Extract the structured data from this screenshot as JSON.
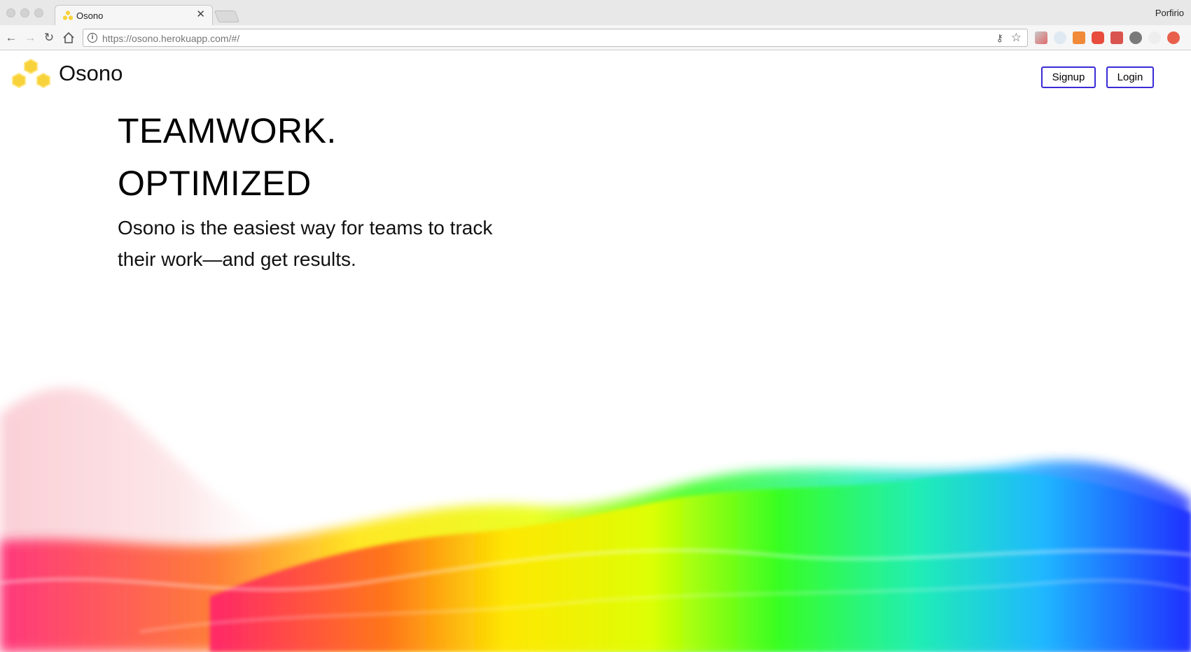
{
  "browser": {
    "tab_title": "Osono",
    "profile_name": "Porfirio",
    "url_host": "https://osono.herokuapp.com",
    "url_path": "/#/"
  },
  "nav": {
    "brand": "Osono",
    "signup_label": "Signup",
    "login_label": "Login"
  },
  "hero": {
    "headline_line1": "TEAMWORK.",
    "headline_line2": "OPTIMIZED",
    "tagline": "Osono is the easiest way for teams to track their work—and get results."
  },
  "colors": {
    "button_border": "#3a2bd6",
    "logo": "#f7d23a"
  },
  "icons": {
    "back": "back-arrow-icon",
    "forward": "forward-arrow-icon",
    "reload": "reload-icon",
    "home": "home-icon",
    "info": "info-icon",
    "key": "key-icon",
    "bookmark": "star-icon",
    "tab_close": "close-icon"
  }
}
